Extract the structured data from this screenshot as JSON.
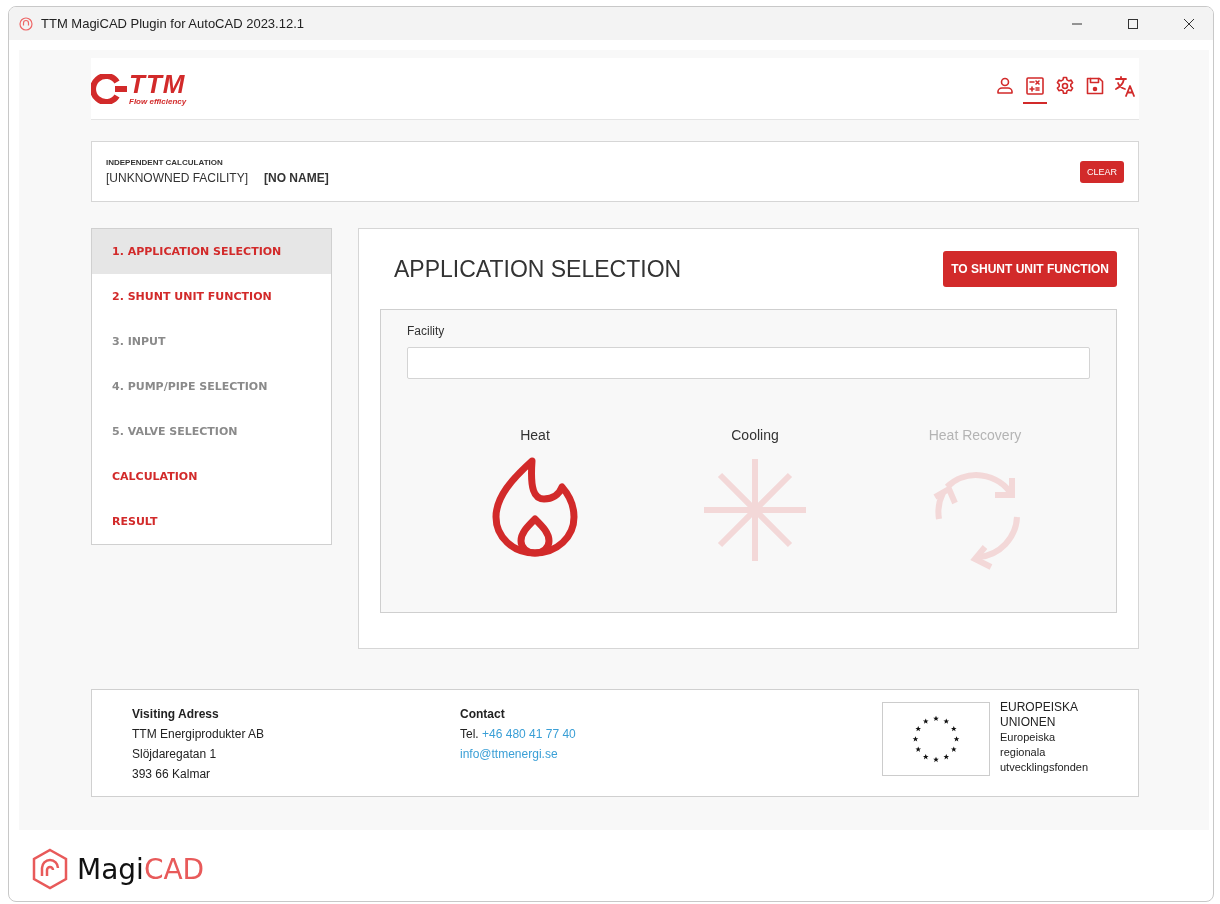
{
  "window": {
    "title": "TTM MagiCAD Plugin for AutoCAD 2023.12.1"
  },
  "logo": {
    "name": "TTM",
    "tagline": "Flow efficiency"
  },
  "toolbar_icons": [
    {
      "kind": "user",
      "selected": false
    },
    {
      "kind": "calculator",
      "selected": true
    },
    {
      "kind": "settings",
      "selected": false
    },
    {
      "kind": "save",
      "selected": false
    },
    {
      "kind": "language",
      "selected": false
    }
  ],
  "project": {
    "label": "INDEPENDENT CALCULATION",
    "facility": "[UNKNOWNED FACILITY]",
    "name": "[NO NAME]",
    "clear_button": "CLEAR"
  },
  "steps": [
    {
      "label": "1. APPLICATION SELECTION",
      "selected": true,
      "disabled": false
    },
    {
      "label": "2. SHUNT UNIT FUNCTION",
      "selected": false,
      "disabled": false
    },
    {
      "label": "3. INPUT",
      "selected": false,
      "disabled": true
    },
    {
      "label": "4. PUMP/PIPE SELECTION",
      "selected": false,
      "disabled": true
    },
    {
      "label": "5. VALVE SELECTION",
      "selected": false,
      "disabled": true
    },
    {
      "label": "CALCULATION",
      "selected": false,
      "disabled": false
    },
    {
      "label": "RESULT",
      "selected": false,
      "disabled": false
    }
  ],
  "main": {
    "title": "APPLICATION SELECTION",
    "next_button": "TO SHUNT UNIT FUNCTION",
    "facility_label": "Facility",
    "applications": [
      {
        "kind": "heat",
        "label": "Heat",
        "selected": true,
        "disabled": false
      },
      {
        "kind": "cooling",
        "label": "Cooling",
        "selected": false,
        "disabled": false
      },
      {
        "kind": "recovery",
        "label": "Heat Recovery",
        "selected": false,
        "disabled": true
      }
    ]
  },
  "footer": {
    "address_title": "Visiting Adress",
    "address_lines": [
      "TTM Energiprodukter AB",
      "Slöjdaregatan 1",
      "393 66 Kalmar"
    ],
    "contact_title": "Contact",
    "phone_prefix": "Tel.",
    "phone": "+46 480 41 77 40",
    "email": "info@ttmenergi.se",
    "eu_lines": [
      "EUROPEISKA",
      "UNIONEN"
    ],
    "eu_sub_lines": [
      "Europeiska",
      "regionala",
      "utvecklingsfonden"
    ]
  },
  "brand": {
    "dark": "Magi",
    "accent": "CAD"
  }
}
